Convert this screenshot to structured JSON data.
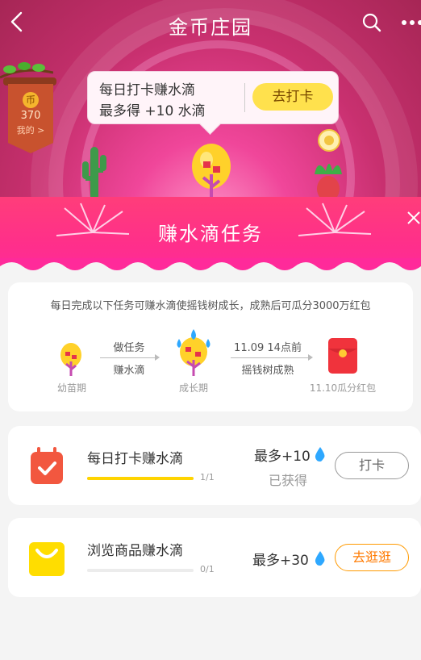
{
  "header": {
    "title": "金币庄园"
  },
  "coins": {
    "badge": "币",
    "count": "370",
    "mine_label": "我的 >"
  },
  "checkin_bubble": {
    "line1": "每日打卡赚水滴",
    "line2": "最多得 +10 水滴",
    "button_label": "去打卡"
  },
  "sheet": {
    "title": "赚水滴任务",
    "description": "每日完成以下任务可赚水滴使摇钱树成长，成熟后可瓜分3000万红包",
    "stages": [
      {
        "label": "幼苗期"
      },
      {
        "label": "成长期"
      },
      {
        "label": "11.10瓜分红包"
      }
    ],
    "steps": [
      {
        "top": "做任务",
        "bottom": "赚水滴"
      },
      {
        "top": "11.09 14点前",
        "bottom": "摇钱树成熟"
      }
    ]
  },
  "tasks": [
    {
      "title": "每日打卡赚水滴",
      "progress_text": "1/1",
      "progress": 1.0,
      "reward": "最多+10",
      "status": "已获得",
      "button_label": "打卡"
    },
    {
      "title": "浏览商品赚水滴",
      "progress_text": "0/1",
      "progress": 0.0,
      "reward": "最多+30",
      "button_label": "去逛逛"
    }
  ],
  "colors": {
    "accent": "#ff2f8a",
    "progress": "#ffd400",
    "orange": "#ff9a00",
    "drop": "#2ea8ff"
  }
}
